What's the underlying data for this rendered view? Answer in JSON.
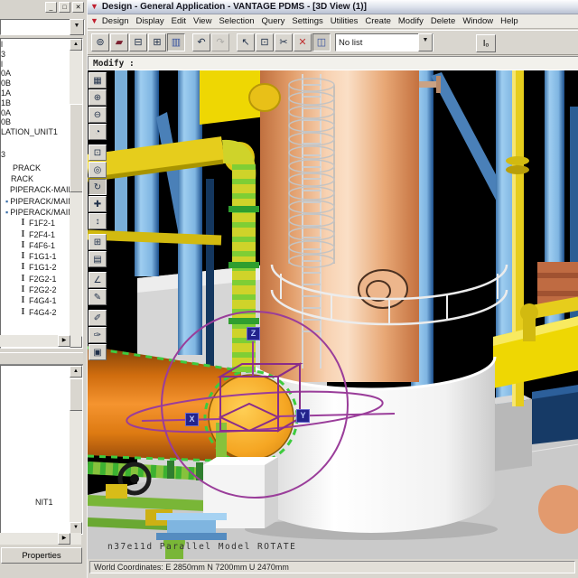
{
  "window": {
    "title": "Design - General Application - VANTAGE PDMS - [3D View (1)]",
    "logo_glyph": "▼"
  },
  "left_panel": {
    "controls": [
      {
        "name": "panel-minimize-button",
        "glyph": "_"
      },
      {
        "name": "panel-maximize-button",
        "glyph": "□"
      },
      {
        "name": "panel-close-button",
        "glyph": "✕"
      }
    ],
    "combo_value": "",
    "combo_arrow_glyph": "▼",
    "tree_top_fragments": [
      "l",
      "3",
      "l",
      "0A",
      "0B",
      "1A",
      "1B",
      "0A",
      "0B",
      "LATION_UNIT1",
      "3"
    ],
    "tree_main": [
      {
        "icon_glyph": "",
        "icon_type": "none",
        "label": "PRACK",
        "style": "padding-left:2px"
      },
      {
        "icon_glyph": "",
        "icon_type": "none",
        "label": "RACK",
        "style": "padding-left:0px"
      },
      {
        "icon_glyph": "",
        "icon_type": "none",
        "label": "PIPERACK-MAIN",
        "style": "padding-left:8px"
      },
      {
        "icon_glyph": "▪",
        "icon_type": "box",
        "label": "PIPERACK/MAIN/",
        "style": "padding-left:5px"
      },
      {
        "icon_glyph": "▪",
        "icon_type": "box",
        "label": "PIPERACK/MAIN/",
        "style": "padding-left:5px"
      },
      {
        "icon_glyph": "I",
        "icon_type": "beam",
        "label": "F1F2-1",
        "style": "padding-left:20px"
      },
      {
        "icon_glyph": "I",
        "icon_type": "beam",
        "label": "F2F4-1",
        "style": "padding-left:20px"
      },
      {
        "icon_glyph": "I",
        "icon_type": "beam",
        "label": "F4F6-1",
        "style": "padding-left:20px"
      },
      {
        "icon_glyph": "I",
        "icon_type": "beam",
        "label": "F1G1-1",
        "style": "padding-left:20px"
      },
      {
        "icon_glyph": "I",
        "icon_type": "beam",
        "label": "F1G1-2",
        "style": "padding-left:20px"
      },
      {
        "icon_glyph": "I",
        "icon_type": "beam",
        "label": "F2G2-1",
        "style": "padding-left:20px"
      },
      {
        "icon_glyph": "I",
        "icon_type": "beam",
        "label": "F2G2-2",
        "style": "padding-left:20px"
      },
      {
        "icon_glyph": "I",
        "icon_type": "beam",
        "label": "F4G4-1",
        "style": "padding-left:20px"
      },
      {
        "icon_glyph": "I",
        "icon_type": "beam",
        "label": "F4G4-2",
        "style": "padding-left:20px"
      }
    ],
    "tree2_fragment": "NIT1",
    "properties_label": "Properties",
    "scroll_glyphs": {
      "up": "▲",
      "down": "▼",
      "right": "▶"
    }
  },
  "menu_bar": {
    "logo_glyph": "▼",
    "items": [
      "Design",
      "Display",
      "Edit",
      "View",
      "Selection",
      "Query",
      "Settings",
      "Utilities",
      "Create",
      "Modify",
      "Delete",
      "Window",
      "Help"
    ]
  },
  "toolbar": {
    "buttons": [
      {
        "name": "session-button",
        "glyph": "⊚",
        "style": "color:#20304a"
      },
      {
        "name": "save-work-button",
        "glyph": "▰",
        "style": "color:#7c2030"
      },
      {
        "name": "export-display-button",
        "glyph": "⊟",
        "style": "color:#20304a"
      },
      {
        "name": "import-display-button",
        "glyph": "⊞",
        "style": "color:#20304a"
      },
      {
        "name": "paste-graphics-button",
        "glyph": "▥",
        "style": "color:#334f9e",
        "state": "pressed"
      },
      {
        "name": "undo-button",
        "glyph": "↶",
        "style": "color:#20304a"
      },
      {
        "name": "redo-button",
        "glyph": "↷",
        "style": "color:#888888",
        "state": "disabled"
      },
      {
        "name": "select-cursor-button",
        "glyph": "↖",
        "style": "color:#20304a"
      },
      {
        "name": "forms-button",
        "glyph": "⊡",
        "style": "color:#20304a"
      },
      {
        "name": "cut-button",
        "glyph": "✂",
        "style": "color:#20304a"
      },
      {
        "name": "delete-button",
        "glyph": "✕",
        "style": "color:#c03030"
      },
      {
        "name": "members-list-button",
        "glyph": "◫",
        "style": "color:#334f9e",
        "state": "pressed"
      }
    ],
    "no_list_value": "No list",
    "combo_arrow_glyph": "▼",
    "right_button": {
      "name": "tag-toggle-button",
      "glyph": "Iₒ"
    }
  },
  "prompt_bar": {
    "text": "Modify :"
  },
  "view_tools": [
    {
      "name": "view-presets-button",
      "glyph": "▦"
    },
    {
      "name": "zoom-in-button",
      "glyph": "⊕"
    },
    {
      "name": "zoom-out-button",
      "glyph": "⊖"
    },
    {
      "name": "orbit-view-button",
      "glyph": "◔"
    },
    {
      "name": "zoom-window-button",
      "glyph": "⊡"
    },
    {
      "name": "zoom-dynamic-button",
      "glyph": "◎"
    },
    {
      "name": "rotate-view-button",
      "glyph": "↻",
      "state": "pressed"
    },
    {
      "name": "pan-view-button",
      "glyph": "✚"
    },
    {
      "name": "walk-view-button",
      "glyph": "↕"
    },
    {
      "name": "view-limits-button",
      "glyph": "⊞"
    },
    {
      "name": "clip-view-button",
      "glyph": "▤"
    },
    {
      "name": "measure-button",
      "glyph": "∠"
    },
    {
      "name": "annotate-1-button",
      "glyph": "✎"
    },
    {
      "name": "annotate-2-button",
      "glyph": "✐"
    },
    {
      "name": "annotate-3-button",
      "glyph": "✑"
    },
    {
      "name": "snapshot-button",
      "glyph": "▣"
    }
  ],
  "viewport": {
    "axis_labels": {
      "x": "X",
      "y": "Y",
      "z": "Z"
    },
    "status_text": "n37e11d Parallel Model ROTATE"
  },
  "status_bar": {
    "world_coordinates": "World Coordinates: E 2850mm N 7200mm U 2470mm"
  },
  "colors": {
    "background": "#000000",
    "steel_blue": "#7fb5e2",
    "steel_blue_dark": "#1c4f8c",
    "column_salmon": "#f8d2b2",
    "pipe_yellow": "#e6cd1c",
    "selection_green": "#3ecb3e",
    "exchanger_orange": "#f5942f",
    "gizmo_magenta": "#9a3d9a",
    "skirt_white": "#ffffff",
    "floor_gray": "#cacaca"
  }
}
